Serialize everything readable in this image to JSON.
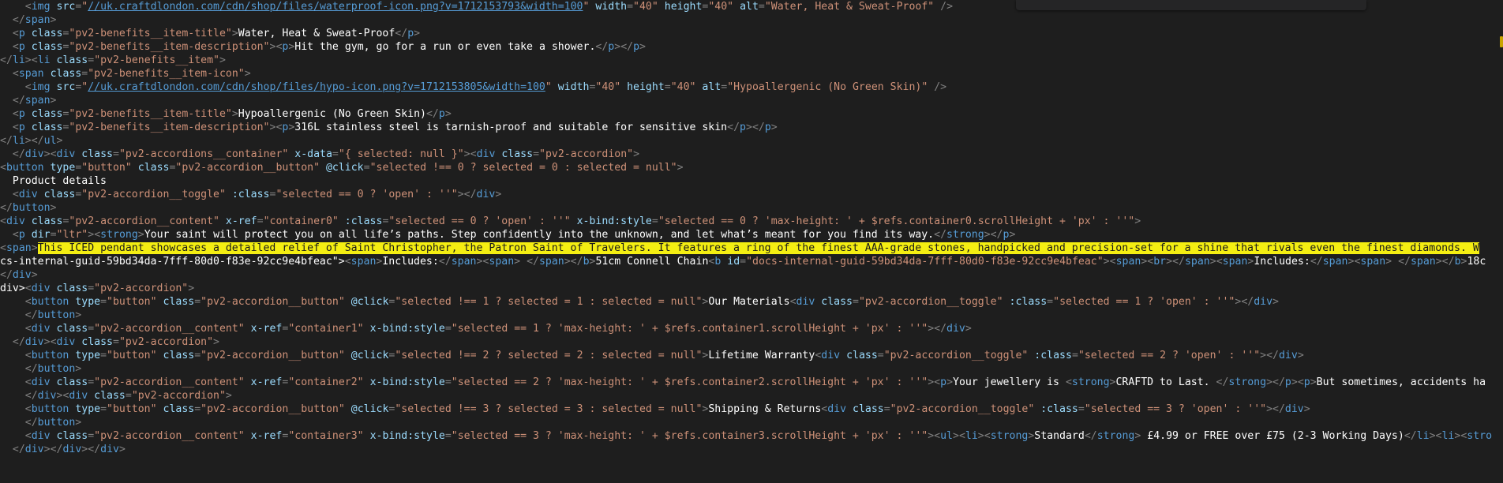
{
  "colors": {
    "background": "#1e1e1e",
    "tag": "#569cd6",
    "attribute": "#9cdcfe",
    "value": "#ce9178",
    "text": "#ffffff",
    "highlight": "#f4ee12"
  },
  "highlighted_line": 18,
  "lines": [
    "    <img src=\"//uk.craftdlondon.com/cdn/shop/files/waterproof-icon.png?v=1712153793&width=100\" width=\"40\" height=\"40\" alt=\"Water, Heat & Sweat-Proof\" />",
    "  </span>",
    "  <p class=\"pv2-benefits__item-title\">Water, Heat & Sweat-Proof</p>",
    "  <p class=\"pv2-benefits__item-description\"><p>Hit the gym, go for a run or even take a shower.</p></p>",
    "</li><li class=\"pv2-benefits__item\">",
    "  <span class=\"pv2-benefits__item-icon\">",
    "    <img src=\"//uk.craftdlondon.com/cdn/shop/files/hypo-icon.png?v=1712153805&width=100\" width=\"40\" height=\"40\" alt=\"Hypoallergenic (No Green Skin)\" />",
    "  </span>",
    "  <p class=\"pv2-benefits__item-title\">Hypoallergenic (No Green Skin)</p>",
    "  <p class=\"pv2-benefits__item-description\"><p>316L stainless steel is tarnish-proof and suitable for sensitive skin</p></p>",
    "</li></ul>",
    "  </div><div class=\"pv2-accordions__container\" x-data=\"{ selected: null }\"><div class=\"pv2-accordion\">",
    "<button type=\"button\" class=\"pv2-accordion__button\" @click=\"selected !== 0 ? selected = 0 : selected = null\">",
    "  Product details",
    "  <div class=\"pv2-accordion__toggle\" :class=\"selected == 0 ? 'open' : ''\"></div>",
    "</button>",
    "<div class=\"pv2-accordion__content\" x-ref=\"container0\" :class=\"selected == 0 ? 'open' : ''\" x-bind:style=\"selected == 0 ? 'max-height: ' + $refs.container0.scrollHeight + 'px' : ''\">",
    "  <p dir=\"ltr\"><strong>Your saint will protect you on all life’s paths. Step confidently into the unknown, and let what’s meant for you find its way.</strong></p>",
    "<span>This ICED pendant showcases a detailed relief of Saint Christopher, the Patron Saint of Travelers. It features a ring of the finest AAA-grade stones, handpicked and precision-set for a shine that rivals even the finest diamonds. W",
    "cs-internal-guid-59bd34da-7fff-80d0-f83e-92cc9e4bfeac\"><span>Includes:</span><span> </span></b>51cm Connell Chain<b id=\"docs-internal-guid-59bd34da-7fff-80d0-f83e-92cc9e4bfeac\"><span><br></span><span>Includes:</span><span> </span></b>18c",
    "</div>",
    "div><div class=\"pv2-accordion\">",
    "    <button type=\"button\" class=\"pv2-accordion__button\" @click=\"selected !== 1 ? selected = 1 : selected = null\">Our Materials<div class=\"pv2-accordion__toggle\" :class=\"selected == 1 ? 'open' : ''\"></div>",
    "    </button>",
    "    <div class=\"pv2-accordion__content\" x-ref=\"container1\" x-bind:style=\"selected == 1 ? 'max-height: ' + $refs.container1.scrollHeight + 'px' : ''\"></div>",
    "  </div><div class=\"pv2-accordion\">",
    "    <button type=\"button\" class=\"pv2-accordion__button\" @click=\"selected !== 2 ? selected = 2 : selected = null\">Lifetime Warranty<div class=\"pv2-accordion__toggle\" :class=\"selected == 2 ? 'open' : ''\"></div>",
    "    </button>",
    "    <div class=\"pv2-accordion__content\" x-ref=\"container2\" x-bind:style=\"selected == 2 ? 'max-height: ' + $refs.container2.scrollHeight + 'px' : ''\"><p>Your jewellery is <strong>CRAFTD to Last. </strong></p><p>But sometimes, accidents ha",
    "    </div><div class=\"pv2-accordion\">",
    "    <button type=\"button\" class=\"pv2-accordion__button\" @click=\"selected !== 3 ? selected = 3 : selected = null\">Shipping & Returns<div class=\"pv2-accordion__toggle\" :class=\"selected == 3 ? 'open' : ''\"></div>",
    "    </button>",
    "    <div class=\"pv2-accordion__content\" x-ref=\"container3\" x-bind:style=\"selected == 3 ? 'max-height: ' + $refs.container3.scrollHeight + 'px' : ''\"><ul><li><strong>Standard</strong> £4.99 or FREE over £75 (2-3 Working Days)</li><li><stro",
    "  </div></div></div>"
  ]
}
